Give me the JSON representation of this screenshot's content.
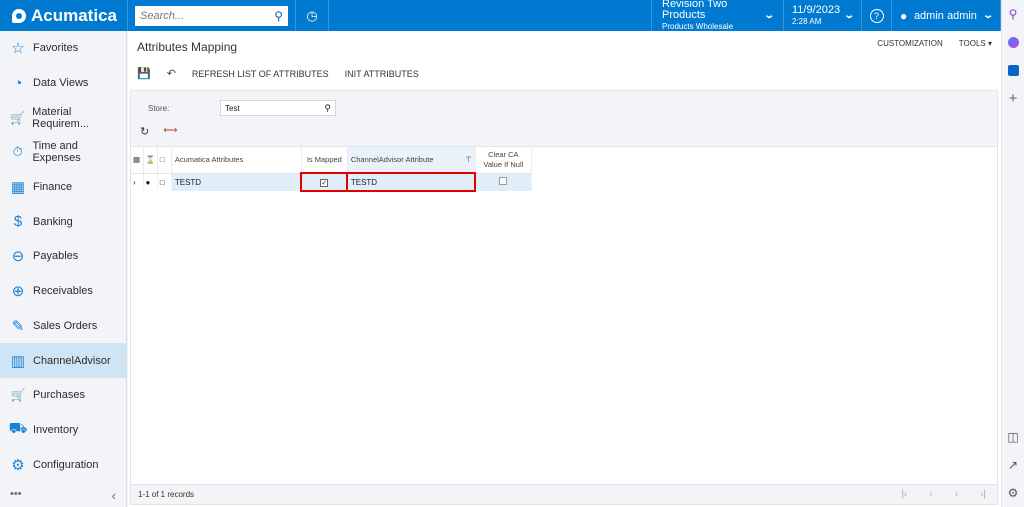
{
  "topbar": {
    "brand": "Acumatica",
    "search_placeholder": "Search...",
    "company": {
      "name": "Revision Two Products",
      "branch": "Products Wholesale"
    },
    "date": {
      "date": "11/9/2023",
      "time": "2:28 AM"
    },
    "user": "admin admin"
  },
  "sidebar": {
    "items": [
      {
        "label": "Favorites",
        "icon": "star-icon",
        "glyph": "☆"
      },
      {
        "label": "Data Views",
        "icon": "pie-chart-icon",
        "glyph": "◔"
      },
      {
        "label": "Material Requirem...",
        "icon": "cart-plus-icon",
        "glyph": "🛒"
      },
      {
        "label": "Time and Expenses",
        "icon": "stopwatch-icon",
        "glyph": "⏱"
      },
      {
        "label": "Finance",
        "icon": "calculator-icon",
        "glyph": "▦"
      },
      {
        "label": "Banking",
        "icon": "dollar-icon",
        "glyph": "$"
      },
      {
        "label": "Payables",
        "icon": "minus-circle-icon",
        "glyph": "⊖"
      },
      {
        "label": "Receivables",
        "icon": "plus-circle-icon",
        "glyph": "⊕"
      },
      {
        "label": "Sales Orders",
        "icon": "edit-icon",
        "glyph": "✎"
      },
      {
        "label": "ChannelAdvisor",
        "icon": "building-icon",
        "glyph": "▥",
        "active": true
      },
      {
        "label": "Purchases",
        "icon": "cart-icon",
        "glyph": "🛒"
      },
      {
        "label": "Inventory",
        "icon": "truck-icon",
        "glyph": "⛟"
      },
      {
        "label": "Configuration",
        "icon": "gear-icon",
        "glyph": "⚙"
      }
    ],
    "more": "•••",
    "collapse": "‹"
  },
  "page": {
    "title": "Attributes Mapping",
    "customization": "CUSTOMIZATION",
    "tools": "TOOLS ▾",
    "toolbar": {
      "refresh_list": "REFRESH LIST OF ATTRIBUTES",
      "init_attributes": "INIT ATTRIBUTES"
    },
    "form": {
      "store_label": "Store:",
      "store_value": "Test"
    },
    "grid": {
      "columns": {
        "acumatica": "Acumatica Attributes",
        "is_mapped": "Is Mapped",
        "ca_attribute": "ChannelAdvisor Attribute",
        "clear_ca_1": "Clear CA",
        "clear_ca_2": "Value If Null"
      },
      "rows": [
        {
          "acumatica": "TESTD",
          "is_mapped": true,
          "ca_attribute": "TESTD",
          "clear_ca": false
        }
      ],
      "records": "1-1 of 1 records"
    }
  }
}
